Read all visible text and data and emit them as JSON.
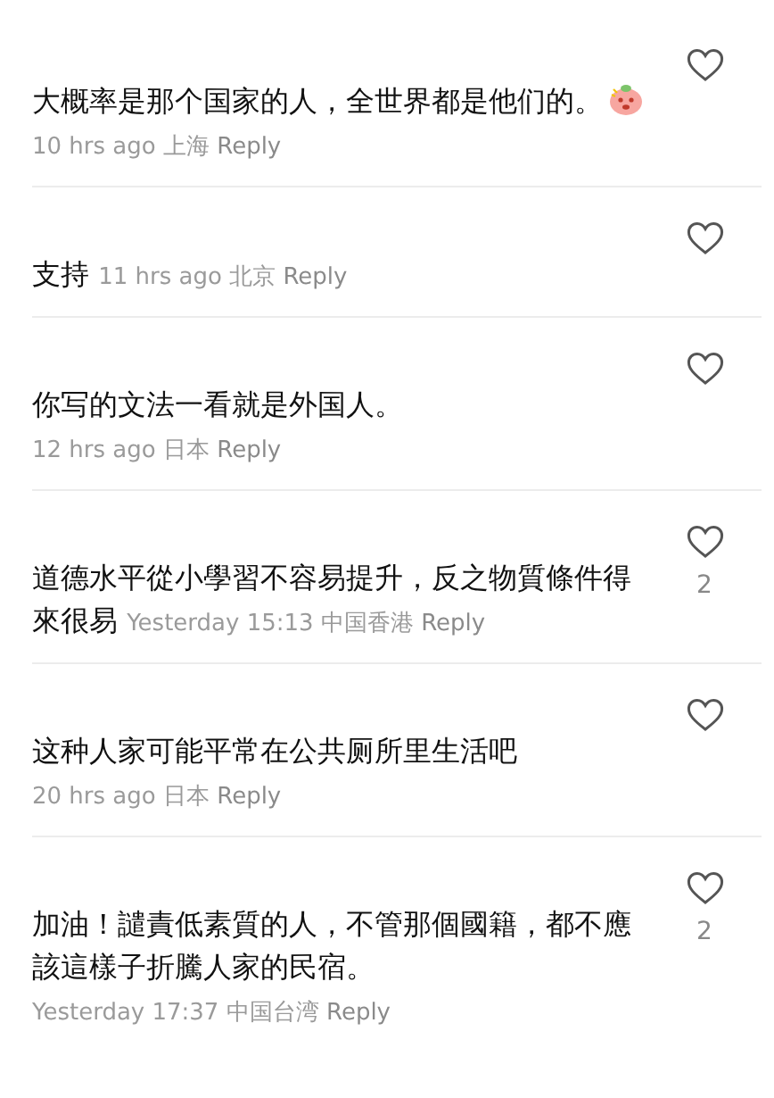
{
  "comments": [
    {
      "lines": [
        "大概率是那个国家的人，全世界都是他们的。"
      ],
      "emoji": true,
      "time": "10 hrs ago",
      "location": "上海",
      "reply": "Reply",
      "liked": false
    },
    {
      "lines": [
        "支持"
      ],
      "time": "11 hrs ago",
      "location": "北京",
      "reply": "Reply",
      "liked": false
    },
    {
      "lines": [
        "你写的文法一看就是外国人。"
      ],
      "time": "12 hrs ago",
      "location": "日本",
      "reply": "Reply",
      "liked": false
    },
    {
      "lines": [
        "道德水平從小學習不容易提升，反之物質條件得",
        "來很易"
      ],
      "time": "Yesterday 15:13",
      "location": "中国香港",
      "reply": "Reply",
      "liked": false,
      "likes": "2"
    },
    {
      "lines": [
        "这种人家可能平常在公共厕所里生活吧"
      ],
      "time": "20 hrs ago",
      "location": "日本",
      "reply": "Reply",
      "liked": false
    },
    {
      "lines": [
        "加油！譴責低素質的人，不管那個國籍，都不應",
        "該這樣子折騰人家的民宿。"
      ],
      "time": "Yesterday 17:37",
      "location": "中国台湾",
      "reply": "Reply",
      "liked": false,
      "likes": "2"
    }
  ]
}
